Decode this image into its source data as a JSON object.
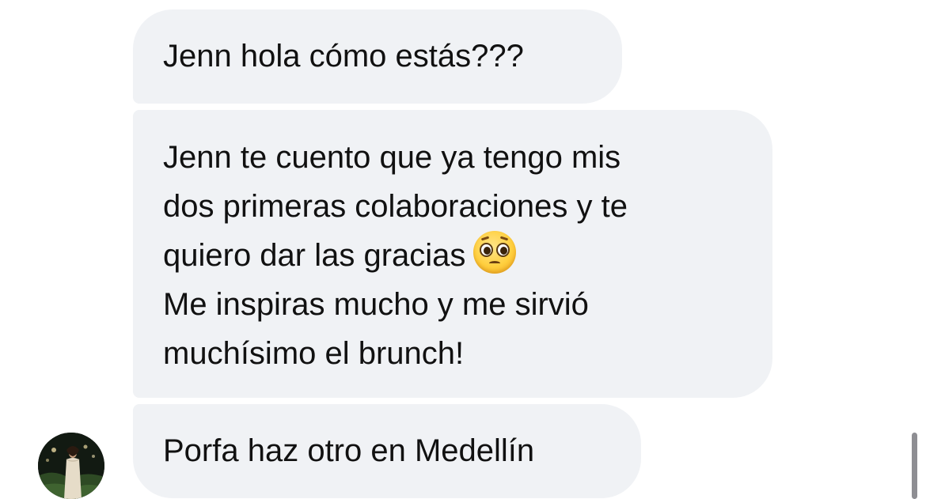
{
  "messages": [
    {
      "lines": [
        "Jenn hola cómo estás???"
      ]
    },
    {
      "lines": [
        "Jenn te cuento que ya tengo mis",
        "dos primeras colaboraciones y te",
        "quiero dar las gracias",
        "Me inspiras mucho y me sirvió",
        "muchísimo el brunch!"
      ],
      "emoji": "pleading-face-icon"
    },
    {
      "lines": [
        "Porfa haz otro en Medellín"
      ]
    }
  ],
  "colors": {
    "bubble_bg": "#f0f2f5",
    "text": "#111111",
    "scrollbar": "#8e8e93"
  }
}
